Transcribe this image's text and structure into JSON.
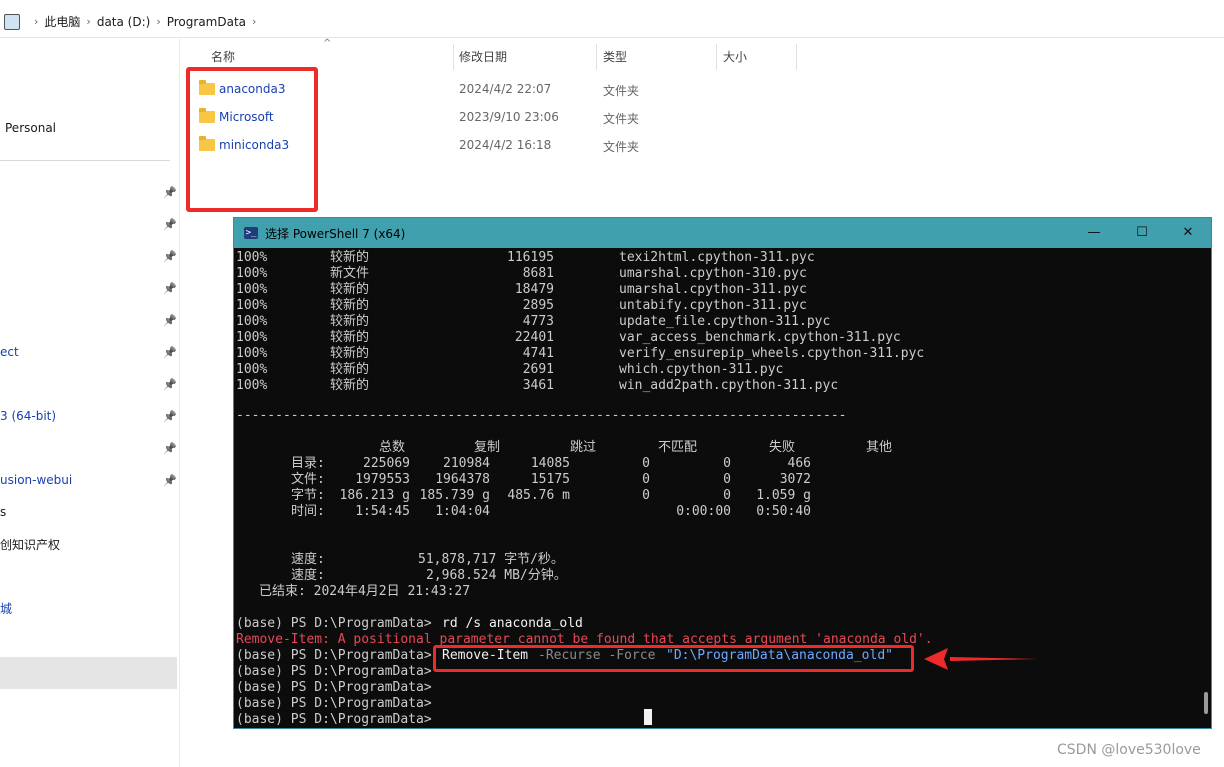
{
  "breadcrumb": [
    "此电脑",
    "data (D:)",
    "ProgramData"
  ],
  "nav": {
    "items": [
      {
        "label": "Personal",
        "pinned": false,
        "blue": false
      },
      {
        "label": "",
        "pinned": true,
        "blue": false
      },
      {
        "label": "",
        "pinned": true,
        "blue": false
      },
      {
        "label": "",
        "pinned": true,
        "blue": false
      },
      {
        "label": "",
        "pinned": true,
        "blue": false
      },
      {
        "label": "",
        "pinned": true,
        "blue": false
      },
      {
        "label": "ect",
        "pinned": true,
        "blue": true
      },
      {
        "label": "",
        "pinned": true,
        "blue": false
      },
      {
        "label": "3 (64-bit)",
        "pinned": true,
        "blue": true
      },
      {
        "label": "",
        "pinned": true,
        "blue": false
      },
      {
        "label": "usion-webui",
        "pinned": true,
        "blue": true
      },
      {
        "label": "s",
        "pinned": false,
        "blue": false
      },
      {
        "label": "创知识产权",
        "pinned": false,
        "blue": false
      },
      {
        "label": "城",
        "pinned": false,
        "blue": true
      }
    ]
  },
  "file_list": {
    "columns": [
      "名称",
      "修改日期",
      "类型",
      "大小"
    ],
    "rows": [
      {
        "name": "anaconda3",
        "date": "2024/4/2 22:07",
        "type": "文件夹"
      },
      {
        "name": "Microsoft",
        "date": "2023/9/10 23:06",
        "type": "文件夹"
      },
      {
        "name": "miniconda3",
        "date": "2024/4/2 16:18",
        "type": "文件夹"
      }
    ]
  },
  "powershell": {
    "title": "选择 PowerShell 7 (x64)",
    "file_lines": [
      {
        "pct": "100%",
        "status": "较新的",
        "size": "116195",
        "file": "texi2html.cpython-311.pyc"
      },
      {
        "pct": "100%",
        "status": "新文件",
        "size": "8681",
        "file": "umarshal.cpython-310.pyc"
      },
      {
        "pct": "100%",
        "status": "较新的",
        "size": "18479",
        "file": "umarshal.cpython-311.pyc"
      },
      {
        "pct": "100%",
        "status": "较新的",
        "size": "2895",
        "file": "untabify.cpython-311.pyc"
      },
      {
        "pct": "100%",
        "status": "较新的",
        "size": "4773",
        "file": "update_file.cpython-311.pyc"
      },
      {
        "pct": "100%",
        "status": "较新的",
        "size": "22401",
        "file": "var_access_benchmark.cpython-311.pyc"
      },
      {
        "pct": "100%",
        "status": "较新的",
        "size": "4741",
        "file": "verify_ensurepip_wheels.cpython-311.pyc"
      },
      {
        "pct": "100%",
        "status": "较新的",
        "size": "2691",
        "file": "which.cpython-311.pyc"
      },
      {
        "pct": "100%",
        "status": "较新的",
        "size": "3461",
        "file": "win_add2path.cpython-311.pyc"
      }
    ],
    "separator": "------------------------------------------------------------------------------",
    "summary_headers": [
      "总数",
      "复制",
      "跳过",
      "不匹配",
      "失败",
      "其他"
    ],
    "summary_rows": [
      {
        "label": "目录:",
        "values": [
          "225069",
          "210984",
          "14085",
          "0",
          "0",
          "466"
        ]
      },
      {
        "label": "文件:",
        "values": [
          "1979553",
          "1964378",
          "15175",
          "0",
          "0",
          "3072"
        ]
      },
      {
        "label": "字节:",
        "values": [
          "186.213 g",
          "185.739 g",
          "485.76 m",
          "0",
          "0",
          "1.059 g"
        ]
      },
      {
        "label": "时间:",
        "values": [
          "1:54:45",
          "1:04:04",
          "",
          "",
          "0:00:00",
          "0:50:40"
        ]
      }
    ],
    "speed1_label": "速度:",
    "speed1_value": "51,878,717 字节/秒。",
    "speed2_label": "速度:",
    "speed2_value": "2,968.524 MB/分钟。",
    "finished": "已结束: 2024年4月2日 21:43:27",
    "prompt": "(base) PS D:\\ProgramData>",
    "cmd1": "rd /s anaconda_old",
    "error": "Remove-Item: A positional parameter cannot be found that accepts argument 'anaconda_old'.",
    "cmd2_name": "Remove-Item",
    "cmd2_params": "-Recurse -Force",
    "cmd2_arg": "\"D:\\ProgramData\\anaconda_old\"",
    "controls": {
      "minimize": "—",
      "maximize": "☐",
      "close": "✕"
    }
  },
  "watermark": "CSDN @love530love",
  "colors": {
    "annotation_red": "#ee2b2b",
    "titlebar": "#40a0ad",
    "terminal_bg": "#0c0c0c",
    "error_red": "#e74856"
  }
}
